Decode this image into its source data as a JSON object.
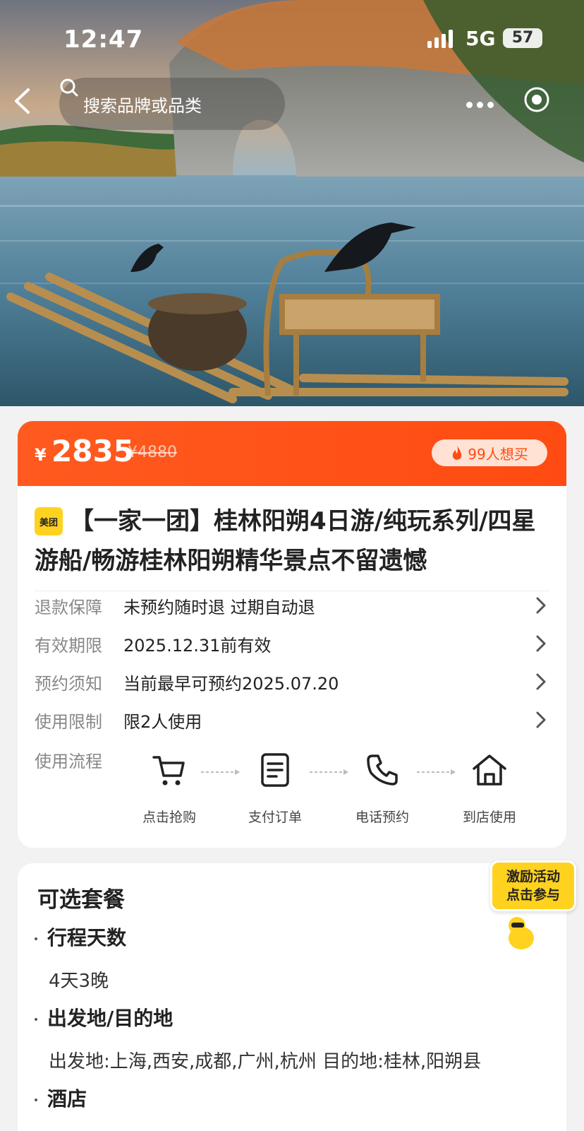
{
  "status_bar": {
    "time": "12:47",
    "network": "5G",
    "battery": "57"
  },
  "nav": {
    "search_placeholder": "搜索品牌或品类"
  },
  "price": {
    "currency": "¥",
    "current": "2835",
    "original": "¥4880",
    "want_count": "99人想买"
  },
  "product": {
    "brand": "美团",
    "title": "【一家一团】桂林阳朔4日游/纯玩系列/四星游船/畅游桂林阳朔精华景点不留遗憾"
  },
  "info_rows": [
    {
      "label": "退款保障",
      "value": "未预约随时退 过期自动退"
    },
    {
      "label": "有效期限",
      "value": "2025.12.31前有效"
    },
    {
      "label": "预约须知",
      "value": "当前最早可预约2025.07.20"
    },
    {
      "label": "使用限制",
      "value": "限2人使用"
    }
  ],
  "flow": {
    "label": "使用流程",
    "steps": [
      {
        "label": "点击抢购",
        "icon": "cart-icon"
      },
      {
        "label": "支付订单",
        "icon": "document-icon"
      },
      {
        "label": "电话预约",
        "icon": "phone-icon"
      },
      {
        "label": "到店使用",
        "icon": "home-icon"
      }
    ]
  },
  "package": {
    "title": "可选套餐",
    "sections": [
      {
        "heading": "行程天数",
        "value": "4天3晚"
      },
      {
        "heading": "出发地/目的地",
        "value": "出发地:上海,西安,成都,广州,杭州 目的地:桂林,阳朔县"
      },
      {
        "heading": "酒店",
        "value": ""
      }
    ]
  },
  "promo": {
    "line1": "激励活动",
    "line2": "点击参与"
  },
  "colors": {
    "accent": "#ff4b12",
    "brand_yellow": "#ffd21f"
  }
}
